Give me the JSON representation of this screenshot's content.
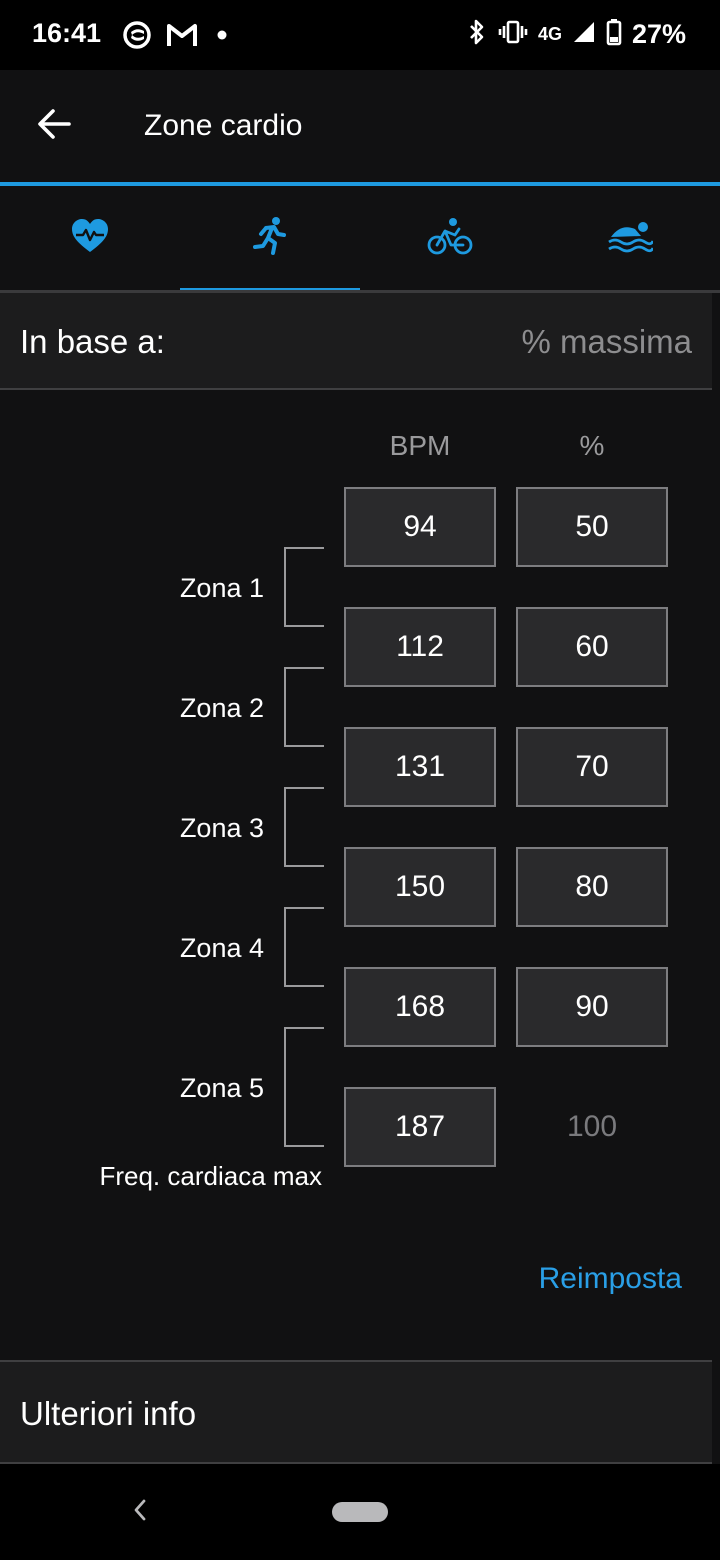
{
  "status_bar": {
    "time": "16:41",
    "network": "4G",
    "battery": "27%",
    "icons": [
      "opera-icon",
      "gmail-icon",
      "dot-icon",
      "bluetooth-icon",
      "vibrate-icon",
      "signal-icon",
      "battery-icon"
    ]
  },
  "app_bar": {
    "title": "Zone cardio",
    "back_icon": "arrow-left-icon"
  },
  "tabs": [
    {
      "icon": "heart-icon",
      "selected": false
    },
    {
      "icon": "running-icon",
      "selected": true
    },
    {
      "icon": "cycling-icon",
      "selected": false
    },
    {
      "icon": "swimming-icon",
      "selected": false
    }
  ],
  "based_on": {
    "label": "In base a:",
    "value": "% massima"
  },
  "columns": {
    "bpm": "BPM",
    "percent": "%"
  },
  "thresholds": [
    {
      "bpm": "94",
      "percent": "50"
    },
    {
      "bpm": "112",
      "percent": "60"
    },
    {
      "bpm": "131",
      "percent": "70"
    },
    {
      "bpm": "150",
      "percent": "80"
    },
    {
      "bpm": "168",
      "percent": "90"
    },
    {
      "bpm": "187",
      "percent": "100"
    }
  ],
  "zones": [
    "Zona 1",
    "Zona 2",
    "Zona 3",
    "Zona 4",
    "Zona 5"
  ],
  "max_hr_label": "Freq. cardiaca max",
  "reset_label": "Reimposta",
  "more_info_label": "Ulteriori info",
  "colors": {
    "accent": "#1e9ae0",
    "background": "#111112",
    "surface": "#1c1c1d"
  }
}
